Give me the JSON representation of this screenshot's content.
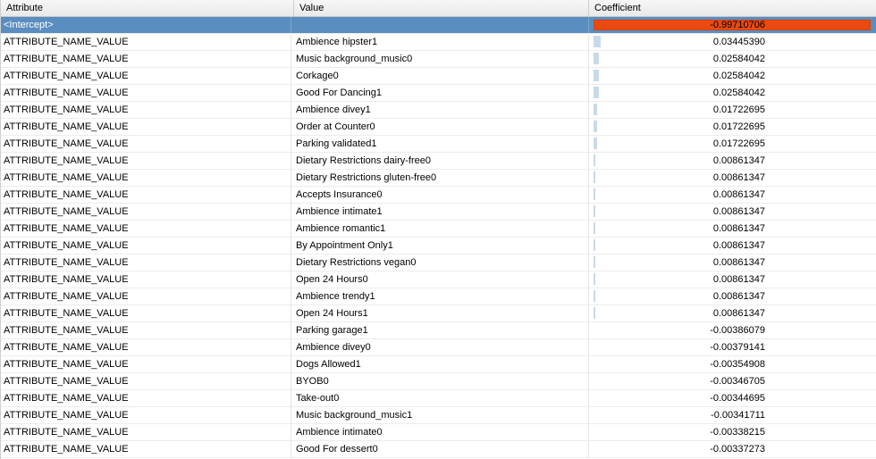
{
  "columns": {
    "attribute": "Attribute",
    "value": "Value",
    "coefficient": "Coefficient"
  },
  "colors": {
    "selected_row": "#5b8ec0",
    "negative_bar": "#ea4a0e",
    "positive_bar": "#c8d9ea"
  },
  "rows": [
    {
      "attribute": "<Intercept>",
      "value": "",
      "coefficient": "-0.99710706",
      "selected": true
    },
    {
      "attribute": "ATTRIBUTE_NAME_VALUE",
      "value": "Ambience hipster1",
      "coefficient": "0.03445390"
    },
    {
      "attribute": "ATTRIBUTE_NAME_VALUE",
      "value": "Music background_music0",
      "coefficient": "0.02584042"
    },
    {
      "attribute": "ATTRIBUTE_NAME_VALUE",
      "value": "Corkage0",
      "coefficient": "0.02584042"
    },
    {
      "attribute": "ATTRIBUTE_NAME_VALUE",
      "value": "Good For Dancing1",
      "coefficient": "0.02584042"
    },
    {
      "attribute": "ATTRIBUTE_NAME_VALUE",
      "value": "Ambience divey1",
      "coefficient": "0.01722695"
    },
    {
      "attribute": "ATTRIBUTE_NAME_VALUE",
      "value": "Order at Counter0",
      "coefficient": "0.01722695"
    },
    {
      "attribute": "ATTRIBUTE_NAME_VALUE",
      "value": "Parking validated1",
      "coefficient": "0.01722695"
    },
    {
      "attribute": "ATTRIBUTE_NAME_VALUE",
      "value": "Dietary Restrictions dairy-free0",
      "coefficient": "0.00861347"
    },
    {
      "attribute": "ATTRIBUTE_NAME_VALUE",
      "value": "Dietary Restrictions gluten-free0",
      "coefficient": "0.00861347"
    },
    {
      "attribute": "ATTRIBUTE_NAME_VALUE",
      "value": "Accepts Insurance0",
      "coefficient": "0.00861347"
    },
    {
      "attribute": "ATTRIBUTE_NAME_VALUE",
      "value": "Ambience intimate1",
      "coefficient": "0.00861347"
    },
    {
      "attribute": "ATTRIBUTE_NAME_VALUE",
      "value": "Ambience romantic1",
      "coefficient": "0.00861347"
    },
    {
      "attribute": "ATTRIBUTE_NAME_VALUE",
      "value": "By Appointment Only1",
      "coefficient": "0.00861347"
    },
    {
      "attribute": "ATTRIBUTE_NAME_VALUE",
      "value": "Dietary Restrictions vegan0",
      "coefficient": "0.00861347"
    },
    {
      "attribute": "ATTRIBUTE_NAME_VALUE",
      "value": "Open 24 Hours0",
      "coefficient": "0.00861347"
    },
    {
      "attribute": "ATTRIBUTE_NAME_VALUE",
      "value": "Ambience trendy1",
      "coefficient": "0.00861347"
    },
    {
      "attribute": "ATTRIBUTE_NAME_VALUE",
      "value": "Open 24 Hours1",
      "coefficient": "0.00861347"
    },
    {
      "attribute": "ATTRIBUTE_NAME_VALUE",
      "value": "Parking garage1",
      "coefficient": "-0.00386079"
    },
    {
      "attribute": "ATTRIBUTE_NAME_VALUE",
      "value": "Ambience divey0",
      "coefficient": "-0.00379141"
    },
    {
      "attribute": "ATTRIBUTE_NAME_VALUE",
      "value": "Dogs Allowed1",
      "coefficient": "-0.00354908"
    },
    {
      "attribute": "ATTRIBUTE_NAME_VALUE",
      "value": "BYOB0",
      "coefficient": "-0.00346705"
    },
    {
      "attribute": "ATTRIBUTE_NAME_VALUE",
      "value": "Take-out0",
      "coefficient": "-0.00344695"
    },
    {
      "attribute": "ATTRIBUTE_NAME_VALUE",
      "value": "Music background_music1",
      "coefficient": "-0.00341711"
    },
    {
      "attribute": "ATTRIBUTE_NAME_VALUE",
      "value": "Ambience intimate0",
      "coefficient": "-0.00338215"
    },
    {
      "attribute": "ATTRIBUTE_NAME_VALUE",
      "value": "Good For dessert0",
      "coefficient": "-0.00337273"
    }
  ]
}
